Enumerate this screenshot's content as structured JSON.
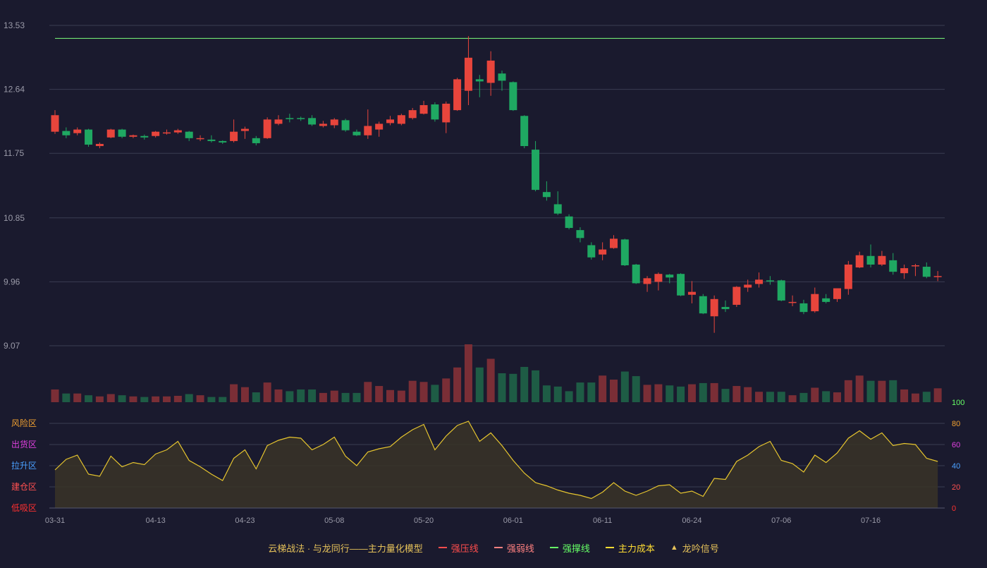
{
  "chart_data": {
    "type": "candlestick",
    "price_axis": {
      "ticks": [
        "13.53",
        "12.64",
        "11.75",
        "10.85",
        "9.96",
        "9.07"
      ],
      "ylim": [
        9.07,
        13.53
      ]
    },
    "x_axis_labels": [
      "03-31",
      "04-13",
      "04-23",
      "05-08",
      "05-20",
      "06-01",
      "06-11",
      "06-24",
      "07-06",
      "07-16"
    ],
    "label_indices": [
      0,
      9,
      17,
      25,
      33,
      41,
      49,
      57,
      65,
      73
    ],
    "resistance_level": 13.35,
    "candles": [
      [
        12.05,
        12.28,
        12.02,
        12.35
      ],
      [
        12.06,
        12.0,
        11.96,
        12.11
      ],
      [
        12.03,
        12.08,
        12.0,
        12.11
      ],
      [
        12.08,
        11.87,
        11.84,
        12.09
      ],
      [
        11.85,
        11.88,
        11.82,
        11.9
      ],
      [
        11.97,
        12.08,
        11.96,
        12.09
      ],
      [
        12.08,
        11.98,
        11.96,
        12.09
      ],
      [
        11.98,
        12.0,
        11.96,
        12.01
      ],
      [
        11.99,
        11.97,
        11.94,
        12.01
      ],
      [
        11.99,
        12.05,
        11.97,
        12.06
      ],
      [
        12.03,
        12.04,
        12.01,
        12.08
      ],
      [
        12.04,
        12.07,
        12.02,
        12.09
      ],
      [
        12.05,
        11.96,
        11.92,
        12.06
      ],
      [
        11.95,
        11.96,
        11.92,
        12.0
      ],
      [
        11.94,
        11.92,
        11.9,
        12.0
      ],
      [
        11.92,
        11.9,
        11.88,
        11.93
      ],
      [
        11.92,
        12.05,
        11.9,
        12.22
      ],
      [
        12.06,
        12.09,
        11.95,
        12.12
      ],
      [
        11.96,
        11.89,
        11.86,
        11.99
      ],
      [
        11.96,
        12.22,
        11.95,
        12.25
      ],
      [
        12.16,
        12.22,
        12.14,
        12.28
      ],
      [
        12.24,
        12.23,
        12.18,
        12.3
      ],
      [
        12.24,
        12.23,
        12.2,
        12.26
      ],
      [
        12.24,
        12.15,
        12.13,
        12.28
      ],
      [
        12.13,
        12.16,
        12.11,
        12.2
      ],
      [
        12.14,
        12.22,
        12.1,
        12.24
      ],
      [
        12.21,
        12.07,
        12.05,
        12.23
      ],
      [
        12.05,
        12.0,
        11.99,
        12.08
      ],
      [
        12.0,
        12.13,
        11.95,
        12.36
      ],
      [
        12.08,
        12.16,
        11.98,
        12.19
      ],
      [
        12.17,
        12.22,
        12.14,
        12.27
      ],
      [
        12.16,
        12.28,
        12.14,
        12.3
      ],
      [
        12.24,
        12.35,
        12.22,
        12.38
      ],
      [
        12.3,
        12.42,
        12.29,
        12.48
      ],
      [
        12.43,
        12.22,
        12.19,
        12.46
      ],
      [
        12.18,
        12.44,
        12.03,
        12.47
      ],
      [
        12.35,
        12.78,
        12.34,
        12.8
      ],
      [
        12.62,
        13.08,
        12.42,
        13.38
      ],
      [
        12.78,
        12.75,
        12.53,
        12.84
      ],
      [
        12.73,
        13.04,
        12.55,
        13.17
      ],
      [
        12.86,
        12.76,
        12.62,
        12.9
      ],
      [
        12.74,
        12.35,
        12.34,
        12.75
      ],
      [
        12.27,
        11.85,
        11.82,
        12.28
      ],
      [
        11.8,
        11.24,
        11.22,
        11.92
      ],
      [
        11.21,
        11.14,
        11.09,
        11.36
      ],
      [
        11.04,
        10.91,
        10.89,
        11.22
      ],
      [
        10.87,
        10.71,
        10.69,
        10.9
      ],
      [
        10.68,
        10.57,
        10.51,
        10.72
      ],
      [
        10.47,
        10.3,
        10.27,
        10.51
      ],
      [
        10.34,
        10.41,
        10.26,
        10.51
      ],
      [
        10.43,
        10.56,
        10.42,
        10.61
      ],
      [
        10.55,
        10.19,
        10.18,
        10.56
      ],
      [
        10.2,
        9.94,
        9.93,
        10.21
      ],
      [
        9.93,
        10.01,
        9.82,
        10.04
      ],
      [
        9.96,
        10.07,
        9.84,
        10.09
      ],
      [
        10.06,
        10.02,
        9.94,
        10.07
      ],
      [
        10.07,
        9.77,
        9.76,
        10.08
      ],
      [
        9.78,
        9.82,
        9.66,
        9.97
      ],
      [
        9.76,
        9.52,
        9.51,
        9.79
      ],
      [
        9.48,
        9.72,
        9.25,
        9.77
      ],
      [
        9.61,
        9.58,
        9.54,
        9.7
      ],
      [
        9.64,
        9.89,
        9.61,
        9.9
      ],
      [
        9.88,
        9.92,
        9.82,
        9.99
      ],
      [
        9.93,
        9.99,
        9.88,
        10.09
      ],
      [
        9.98,
        9.97,
        9.92,
        10.04
      ],
      [
        9.98,
        9.7,
        9.69,
        9.99
      ],
      [
        9.68,
        9.68,
        9.62,
        9.77
      ],
      [
        9.66,
        9.54,
        9.51,
        9.71
      ],
      [
        9.55,
        9.79,
        9.53,
        9.88
      ],
      [
        9.73,
        9.68,
        9.66,
        9.79
      ],
      [
        9.72,
        9.87,
        9.68,
        9.86
      ],
      [
        9.86,
        10.2,
        9.78,
        10.25
      ],
      [
        10.16,
        10.33,
        10.15,
        10.38
      ],
      [
        10.32,
        10.2,
        10.16,
        10.48
      ],
      [
        10.2,
        10.32,
        10.18,
        10.39
      ],
      [
        10.26,
        10.1,
        10.06,
        10.36
      ],
      [
        10.08,
        10.15,
        10.0,
        10.2
      ],
      [
        10.18,
        10.19,
        10.04,
        10.21
      ],
      [
        10.17,
        10.03,
        10.01,
        10.23
      ],
      [
        10.03,
        10.04,
        9.97,
        10.11
      ]
    ],
    "volume": [
      22,
      15,
      15,
      12,
      10,
      14,
      12,
      10,
      9,
      10,
      10,
      11,
      14,
      12,
      9,
      9,
      31,
      26,
      17,
      34,
      22,
      19,
      22,
      22,
      16,
      20,
      16,
      16,
      35,
      28,
      21,
      20,
      37,
      35,
      30,
      41,
      60,
      100,
      60,
      75,
      50,
      49,
      61,
      55,
      29,
      27,
      19,
      34,
      34,
      46,
      39,
      53,
      45,
      30,
      31,
      29,
      27,
      31,
      33,
      33,
      23,
      28,
      26,
      18,
      18,
      18,
      12,
      16,
      25,
      19,
      17,
      38,
      46,
      37,
      37,
      38,
      22,
      15,
      18,
      24
    ],
    "oscillator": {
      "zones": [
        "风险区",
        "出货区",
        "拉升区",
        "建仓区",
        "低吸区"
      ],
      "ticks": [
        "100",
        "80",
        "60",
        "40",
        "20",
        "0"
      ],
      "ylim": [
        0,
        100
      ],
      "values": [
        36,
        46,
        50,
        32,
        30,
        49,
        39,
        43,
        41,
        51,
        55,
        63,
        45,
        39,
        32,
        26,
        47,
        55,
        37,
        59,
        64,
        67,
        66,
        55,
        60,
        67,
        49,
        40,
        53,
        56,
        58,
        67,
        74,
        79,
        55,
        68,
        78,
        82,
        63,
        71,
        59,
        45,
        33,
        24,
        21,
        17,
        14,
        12,
        9,
        15,
        24,
        16,
        12,
        16,
        21,
        22,
        14,
        16,
        11,
        28,
        27,
        44,
        50,
        58,
        63,
        45,
        42,
        34,
        50,
        43,
        52,
        66,
        73,
        65,
        71,
        59,
        61,
        60,
        47,
        44
      ]
    }
  },
  "legend": {
    "title": "云梯战法 · 与龙同行——主力量化模型",
    "items": [
      {
        "label": "强压线",
        "color": "#ff4d4d",
        "style": "solid"
      },
      {
        "label": "强弱线",
        "color": "#ff8080",
        "style": "dash"
      },
      {
        "label": "强撑线",
        "color": "#66ff66",
        "style": "solid"
      },
      {
        "label": "主力成本",
        "color": "#ffdd33",
        "style": "dash"
      },
      {
        "label": "龙吟信号",
        "color": "#e6c25a",
        "style": "triangle"
      }
    ]
  },
  "colors": {
    "up": "#e8453c",
    "down": "#1fa862",
    "vol_up": "#7a2e36",
    "vol_down": "#1e5c45",
    "resistance": "#7dff7d",
    "osc_line": "#e6c52e",
    "osc_fill": "#3a3427",
    "grid": "#3a3d52",
    "text": "#9a9aa8",
    "zone_colors": [
      "#f0a030",
      "#e040e0",
      "#4aa0ff",
      "#ff5050",
      "#ff3030"
    ],
    "tick_colors": [
      "#66ff66",
      "#f0a030",
      "#e040e0",
      "#4aa0ff",
      "#ff5050",
      "#ff3030"
    ]
  }
}
